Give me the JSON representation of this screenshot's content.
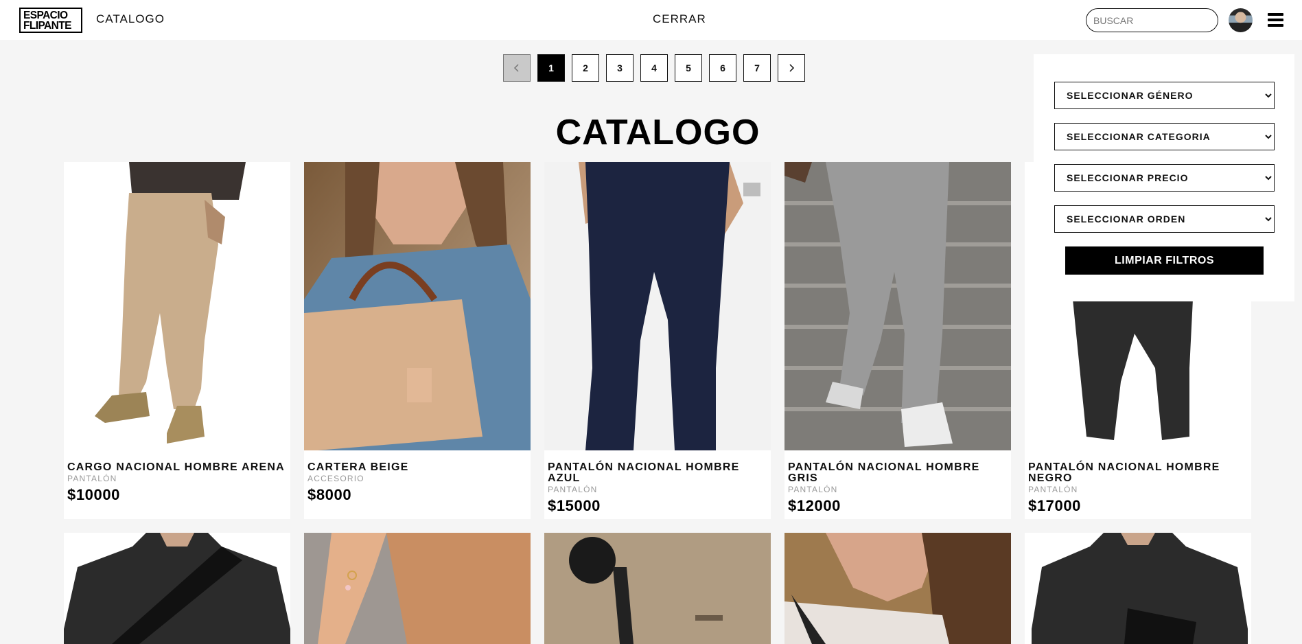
{
  "nav": {
    "logo_line1": "ESPACIO",
    "logo_line2": "FLIPANTE",
    "catalog_link": "CATALOGO",
    "close_link": "CERRAR",
    "search_placeholder": "BUSCAR"
  },
  "pagination": {
    "pages": [
      "1",
      "2",
      "3",
      "4",
      "5",
      "6",
      "7"
    ],
    "current": "1"
  },
  "page_title": "CATALOGO",
  "filters": {
    "gender": "SELECCIONAR GÉNERO",
    "category": "SELECCIONAR CATEGORIA",
    "price": "SELECCIONAR PRECIO",
    "order": "SELECCIONAR ORDEN",
    "clear_label": "LIMPIAR FILTROS"
  },
  "products": [
    {
      "name": "CARGO NACIONAL HOMBRE ARENA",
      "category": "PANTALÓN",
      "price": "$10000"
    },
    {
      "name": "CARTERA BEIGE",
      "category": "ACCESORIO",
      "price": "$8000"
    },
    {
      "name": "PANTALÓN NACIONAL HOMBRE AZUL",
      "category": "PANTALÓN",
      "price": "$15000"
    },
    {
      "name": "PANTALÓN NACIONAL HOMBRE GRIS",
      "category": "PANTALÓN",
      "price": "$12000"
    },
    {
      "name": "PANTALÓN NACIONAL HOMBRE NEGRO",
      "category": "PANTALÓN",
      "price": "$17000"
    }
  ],
  "colors": {
    "accent": "#000000",
    "background": "#f5f5f5"
  }
}
